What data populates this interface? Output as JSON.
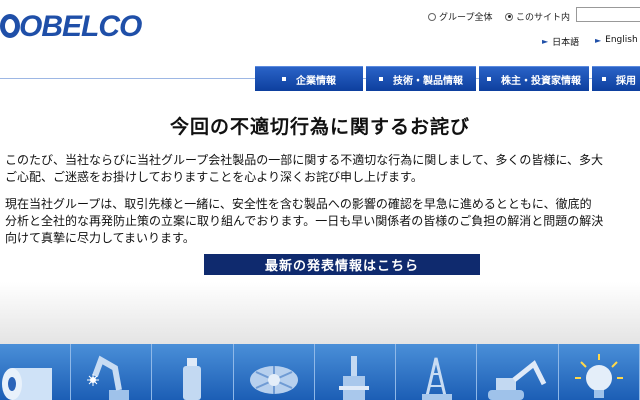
{
  "header": {
    "logo_text": "OBELCO",
    "scope_options": [
      {
        "label": "グループ全体",
        "selected": false
      },
      {
        "label": "このサイト内",
        "selected": true
      }
    ],
    "languages": [
      "日本語",
      "English"
    ]
  },
  "nav": {
    "items": [
      "企業情報",
      "技術・製品情報",
      "株主・投資家情報",
      "採用"
    ]
  },
  "main": {
    "title": "今回の不適切行為に関するお詫び",
    "paragraph1": [
      "このたび、当社ならびに当社グループ会社製品の一部に関する不適切な行為に関しまして、多くの皆様に、多大",
      "ご心配、ご迷惑をお掛けしておりますことを心より深くお詫び申し上げます。"
    ],
    "paragraph2": [
      "現在当社グループは、取引先様と一緒に、安全性を含む製品への影響の確認を早急に進めるとともに、徹底的",
      "分析と全社的な再発防止策の立案に取り組んでおります。一日も早い関係者の皆様のご負担の解消と問題の解決",
      "向けて真摯に尽力してまいります。"
    ],
    "latest_button": "最新の発表情報はこちら"
  },
  "icon_bar": {
    "icons": [
      "steel-coil-icon",
      "welding-robot-icon",
      "cylinder-icon",
      "machinery-icon",
      "plant-icon",
      "crane-icon",
      "excavator-icon",
      "lightbulb-icon"
    ]
  },
  "colors": {
    "brand_blue": "#1f4fa8",
    "nav_blue": "#0d3f9e",
    "button_navy": "#0f2a6e",
    "icon_bar_blue": "#1c5eb5"
  }
}
